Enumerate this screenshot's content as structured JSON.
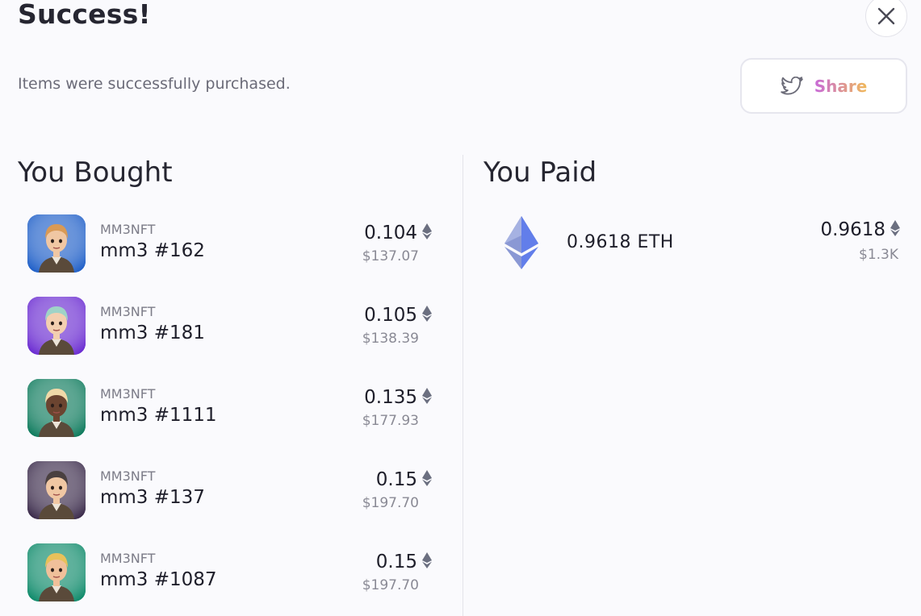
{
  "header": {
    "title": "Success!",
    "subtitle": "Items were successfully purchased.",
    "share_label": "Share",
    "close_icon": "close-icon",
    "twitter_icon": "twitter-icon"
  },
  "bought": {
    "heading": "You Bought",
    "items": [
      {
        "collection": "MM3NFT",
        "name": "mm3 #162",
        "price": "0.104",
        "usd": "$137.07",
        "avatar_bg": "#1f5fc8"
      },
      {
        "collection": "MM3NFT",
        "name": "mm3 #181",
        "price": "0.105",
        "usd": "$138.39",
        "avatar_bg": "#6a2bd1"
      },
      {
        "collection": "MM3NFT",
        "name": "mm3 #1111",
        "price": "0.135",
        "usd": "$177.93",
        "avatar_bg": "#0d7a5c"
      },
      {
        "collection": "MM3NFT",
        "name": "mm3 #137",
        "price": "0.15",
        "usd": "$197.70",
        "avatar_bg": "#3a2a4a"
      },
      {
        "collection": "MM3NFT",
        "name": "mm3 #1087",
        "price": "0.15",
        "usd": "$197.70",
        "avatar_bg": "#0e8a6a"
      }
    ]
  },
  "paid": {
    "heading": "You Paid",
    "amount_label": "0.9618 ETH",
    "price": "0.9618",
    "usd": "$1.3K"
  },
  "colors": {
    "eth": "#627eea",
    "eth_small": "#6b6f80",
    "share_gradient_start": "#c86ad8",
    "share_gradient_end": "#f0b95a"
  }
}
